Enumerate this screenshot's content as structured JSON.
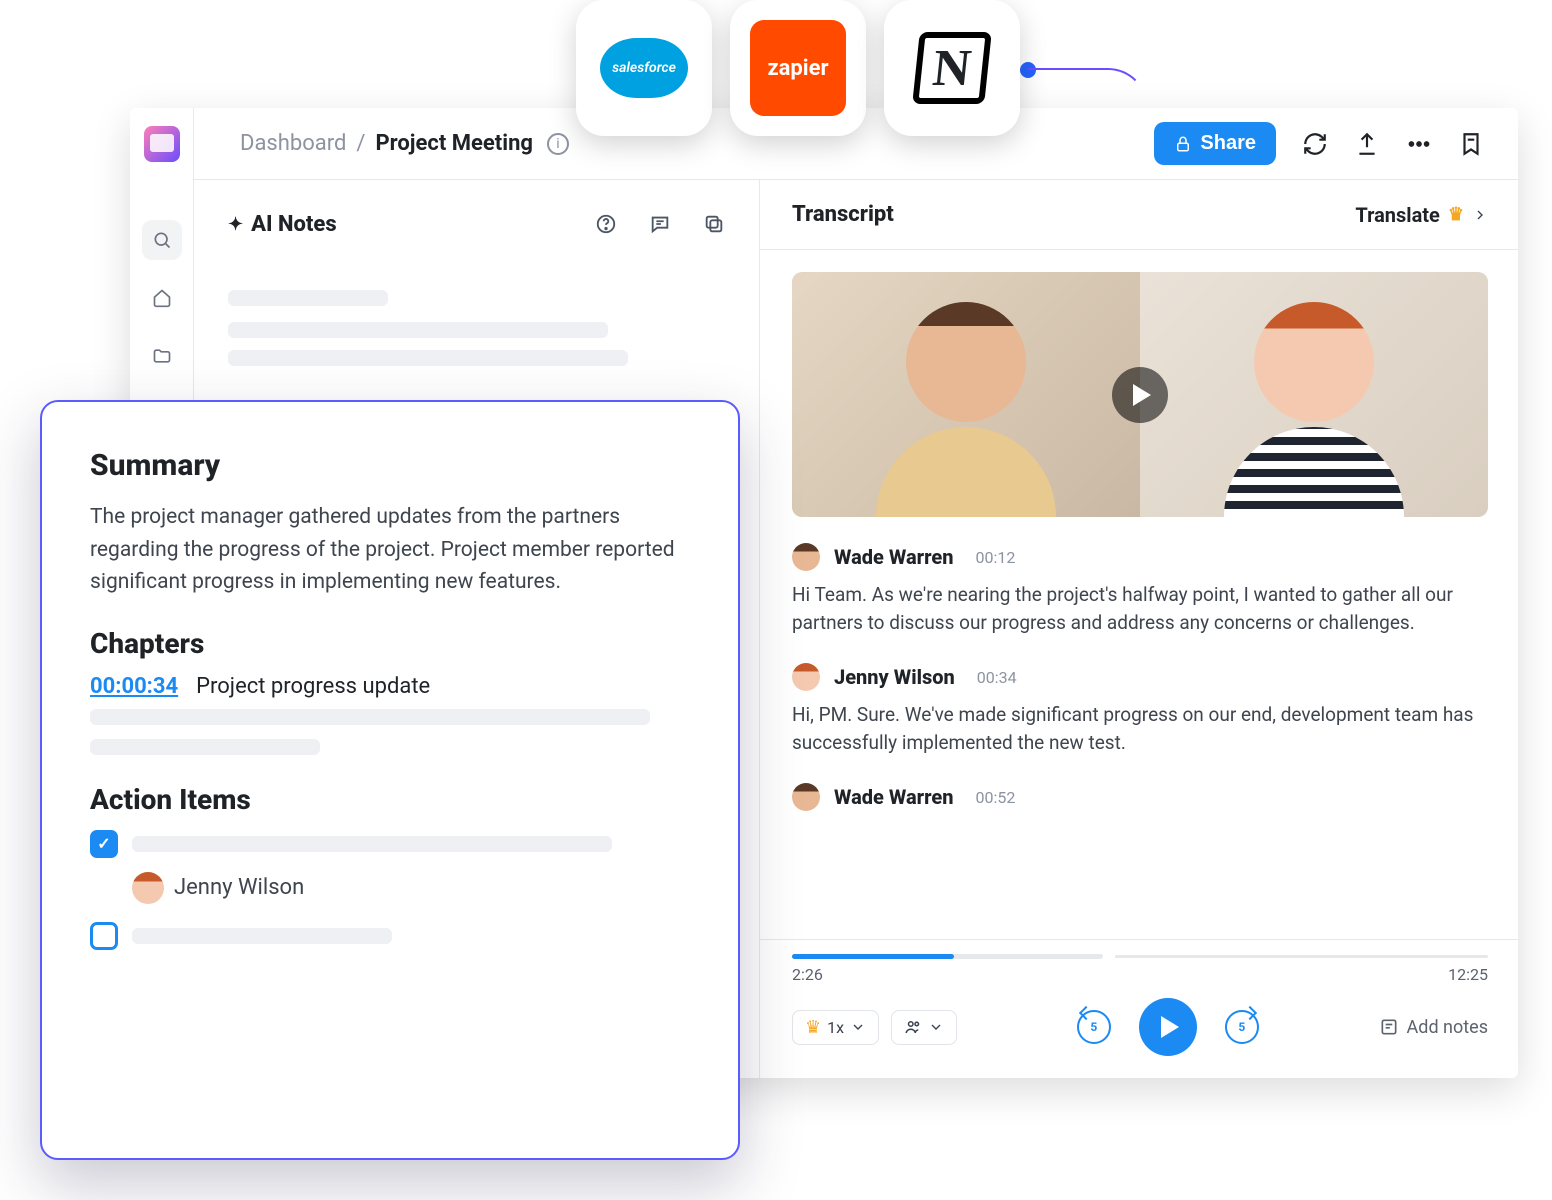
{
  "integrations": {
    "salesforce": "salesforce",
    "zapier": "zapier",
    "notion_letter": "N"
  },
  "breadcrumb": {
    "root": "Dashboard",
    "separator": "/",
    "current": "Project Meeting"
  },
  "topbar": {
    "share": "Share"
  },
  "ai_notes": {
    "title": "AI Notes"
  },
  "transcript": {
    "title": "Transcript",
    "translate": "Translate",
    "entries": [
      {
        "speaker": "Wade Warren",
        "time": "00:12",
        "text": "Hi Team. As we're nearing the project's halfway point, I wanted to gather all our partners to discuss our progress and address any concerns or challenges."
      },
      {
        "speaker": "Jenny Wilson",
        "time": "00:34",
        "text": "Hi, PM. Sure. We've made significant progress on our end, development team has successfully implemented the new test."
      },
      {
        "speaker": "Wade Warren",
        "time": "00:52",
        "text": ""
      }
    ]
  },
  "player": {
    "elapsed": "2:26",
    "total": "12:25",
    "speed": "1x",
    "jump": "5",
    "add_notes": "Add notes"
  },
  "summary_card": {
    "summary_heading": "Summary",
    "summary_text": "The project manager gathered updates from the partners regarding the progress of the project. Project member reported significant progress in implementing new features.",
    "chapters_heading": "Chapters",
    "chapter_time": "00:00:34",
    "chapter_title": "Project progress update",
    "action_heading": "Action Items",
    "assignee": "Jenny Wilson"
  }
}
